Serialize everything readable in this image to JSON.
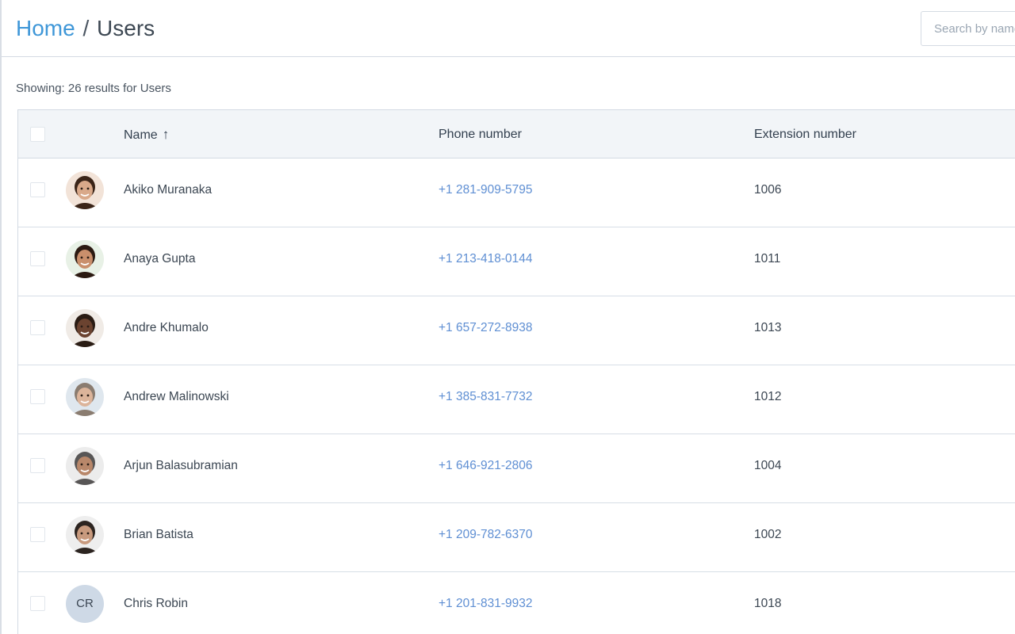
{
  "breadcrumb": {
    "home": "Home",
    "separator": "/",
    "current": "Users"
  },
  "search": {
    "placeholder": "Search by name",
    "value": ""
  },
  "results_text": "Showing: 26 results for Users",
  "table": {
    "columns": {
      "name": "Name",
      "phone": "Phone number",
      "extension": "Extension number"
    },
    "sort": {
      "column": "name",
      "direction": "ascending",
      "icon": "arrow-up-icon"
    },
    "rows": [
      {
        "name": "Akiko Muranaka",
        "phone": "+1 281-909-5795",
        "extension": "1006",
        "avatar": "photo"
      },
      {
        "name": "Anaya Gupta",
        "phone": "+1 213-418-0144",
        "extension": "1011",
        "avatar": "photo"
      },
      {
        "name": "Andre Khumalo",
        "phone": "+1 657-272-8938",
        "extension": "1013",
        "avatar": "photo"
      },
      {
        "name": "Andrew Malinowski",
        "phone": "+1 385-831-7732",
        "extension": "1012",
        "avatar": "photo"
      },
      {
        "name": "Arjun Balasubramian",
        "phone": "+1 646-921-2806",
        "extension": "1004",
        "avatar": "photo"
      },
      {
        "name": "Brian Batista",
        "phone": "+1 209-782-6370",
        "extension": "1002",
        "avatar": "photo"
      },
      {
        "name": "Chris Robin",
        "phone": "+1 201-831-9932",
        "extension": "1018",
        "avatar": "initials",
        "initials": "CR"
      }
    ]
  },
  "colors": {
    "link": "#3f97d8",
    "phone_link": "#5f8fd3",
    "header_bg": "#f2f5f8",
    "border": "#d3dae3",
    "initials_bg": "#ced9e6"
  }
}
